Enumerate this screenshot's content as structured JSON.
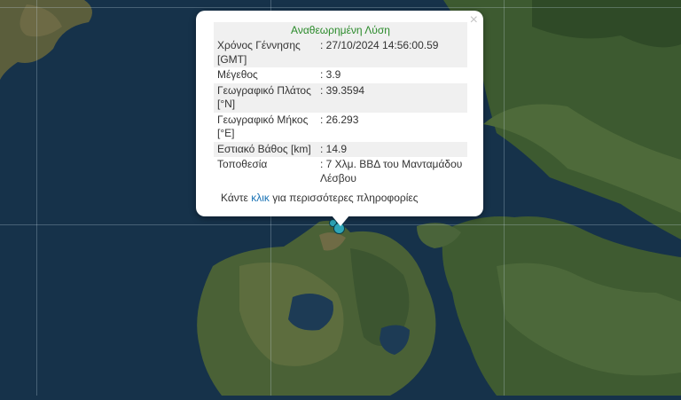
{
  "popup": {
    "title": "Αναθεωρημένη Λύση",
    "close_symbol": "×",
    "rows": [
      {
        "label": "Χρόνος Γέννησης [GMT]",
        "value": ": 27/10/2024 14:56:00.59"
      },
      {
        "label": "Μέγεθος",
        "value": ": 3.9"
      },
      {
        "label": "Γεωγραφικό Πλάτος [°N]",
        "value": ": 39.3594"
      },
      {
        "label": "Γεωγραφικό Μήκος [°E]",
        "value": ": 26.293"
      },
      {
        "label": "Εστιακό Βάθος [km]",
        "value": ": 14.9"
      },
      {
        "label": "Τοποθεσία",
        "value": ": 7 Χλμ. ΒΒΔ του Μανταμάδου Λέσβου"
      }
    ],
    "more_prefix": "Κάντε ",
    "more_link": "κλικ",
    "more_suffix": " για περισσότερες πληροφορίες"
  },
  "colors": {
    "sea": "#16324a",
    "land": "#3f5a33",
    "accent_title": "#2a8a2a",
    "marker": "#2ea6b8"
  }
}
